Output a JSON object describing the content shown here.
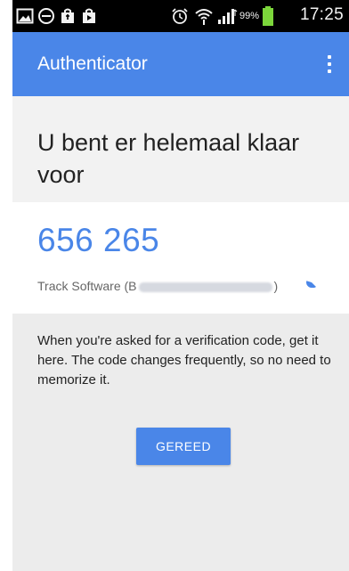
{
  "status_bar": {
    "battery_percent": "99%",
    "time": "17:25",
    "icons_left": [
      "gallery-icon",
      "minus-circle-icon",
      "shop-bag-icon",
      "play-store-icon"
    ],
    "icons_right": [
      "alarm-icon",
      "wifi-icon",
      "signal-icon",
      "battery-icon"
    ]
  },
  "app_bar": {
    "title": "Authenticator",
    "menu_icon": "more-vertical-icon"
  },
  "heading": {
    "text": "U bent er helemaal klaar voor"
  },
  "code_card": {
    "code": "656 265",
    "account_prefix": "Track Software (B",
    "account_suffix": ")",
    "countdown_icon": "countdown-pie-icon"
  },
  "info": {
    "text": "When you're asked for a verification code, get it here. The code changes frequently, so no need to memorize it."
  },
  "done_button": {
    "label": "GEREED"
  },
  "colors": {
    "accent": "#4a86e8",
    "background": "#ececec",
    "card": "#ffffff",
    "status_bar": "#000000",
    "battery": "#7cd63b"
  }
}
